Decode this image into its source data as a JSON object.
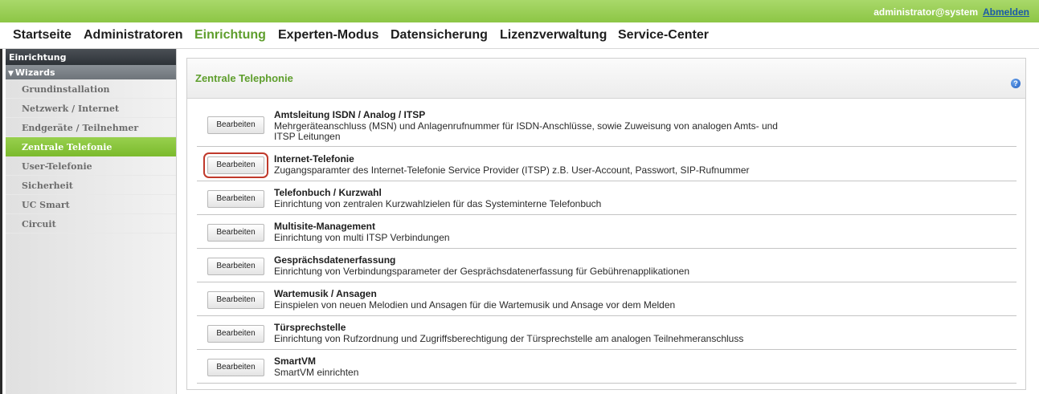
{
  "topbar": {
    "user": "administrator@system",
    "logout": "Abmelden"
  },
  "menu": {
    "items": [
      {
        "label": "Startseite"
      },
      {
        "label": "Administratoren"
      },
      {
        "label": "Einrichtung"
      },
      {
        "label": "Experten-Modus"
      },
      {
        "label": "Datensicherung"
      },
      {
        "label": "Lizenzverwaltung"
      },
      {
        "label": "Service-Center"
      }
    ],
    "active": "Einrichtung"
  },
  "sidebar": {
    "header": "Einrichtung",
    "group": "Wizards",
    "items": [
      {
        "label": "Grundinstallation"
      },
      {
        "label": "Netzwerk / Internet"
      },
      {
        "label": "Endgeräte / Teilnehmer"
      },
      {
        "label": "Zentrale Telefonie"
      },
      {
        "label": "User-Telefonie"
      },
      {
        "label": "Sicherheit"
      },
      {
        "label": "UC Smart"
      },
      {
        "label": "Circuit"
      }
    ],
    "active": "Zentrale Telefonie"
  },
  "panel": {
    "title": "Zentrale Telephonie",
    "help_icon": "question-icon",
    "rows": [
      {
        "button": "Bearbeiten",
        "title": "Amtsleitung ISDN / Analog / ITSP",
        "desc": "Mehrgeräteanschluss (MSN) und Anlagenrufnummer für ISDN-Anschlüsse, sowie Zuweisung von analogen Amts- und ITSP Leitungen"
      },
      {
        "button": "Bearbeiten",
        "title": "Internet-Telefonie",
        "desc": "Zugangsparamter des Internet-Telefonie Service Provider (ITSP) z.B. User-Account, Passwort, SIP-Rufnummer"
      },
      {
        "button": "Bearbeiten",
        "title": "Telefonbuch / Kurzwahl",
        "desc": "Einrichtung von zentralen Kurzwahlzielen für das Systeminterne Telefonbuch"
      },
      {
        "button": "Bearbeiten",
        "title": "Multisite-Management",
        "desc": "Einrichtung von multi ITSP Verbindungen"
      },
      {
        "button": "Bearbeiten",
        "title": "Gesprächsdatenerfassung",
        "desc": "Einrichtung von Verbindungsparameter der Gesprächsdatenerfassung für Gebührenapplikationen"
      },
      {
        "button": "Bearbeiten",
        "title": "Wartemusik / Ansagen",
        "desc": "Einspielen von neuen Melodien und Ansagen für die Wartemusik und Ansage vor dem Melden"
      },
      {
        "button": "Bearbeiten",
        "title": "Türsprechstelle",
        "desc": "Einrichtung von Rufzordnung und Zugriffsberechtigung der Türsprechstelle am analogen Teilnehmeranschluss"
      },
      {
        "button": "Bearbeiten",
        "title": "SmartVM",
        "desc": "SmartVM einrichten"
      }
    ]
  },
  "colors": {
    "brand_green": "#8cc645",
    "active_text": "#5e9e2c",
    "highlight": "#c0392b"
  }
}
